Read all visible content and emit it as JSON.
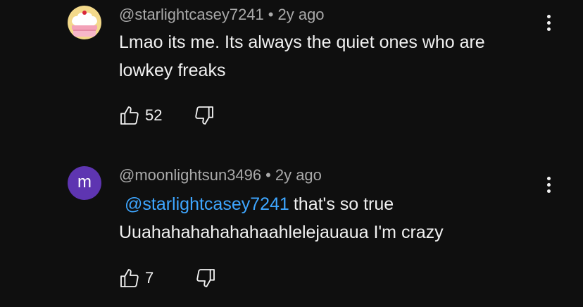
{
  "comments": [
    {
      "username": "@starlightcasey7241",
      "separator": "•",
      "time": "2y ago",
      "text_line1": "Lmao its me. Its always the quiet ones who are",
      "text_line2": "lowkey freaks",
      "likes": "52",
      "avatar_icon": "cake-avatar-icon"
    },
    {
      "username": "@moonlightsun3496",
      "separator": "•",
      "time": "2y ago",
      "avatar_letter": "m",
      "avatar_color": "#5e35b1",
      "mention": "@starlightcasey7241",
      "text_line1_rest": "that's so true",
      "text_line2": "Uuahahahahahahaahlelejauaua I'm crazy",
      "likes": "7"
    }
  ],
  "colors": {
    "background": "#0f0f0f",
    "text": "#f1f1f1",
    "meta": "#aaaaaa",
    "mention": "#3ea6ff"
  }
}
